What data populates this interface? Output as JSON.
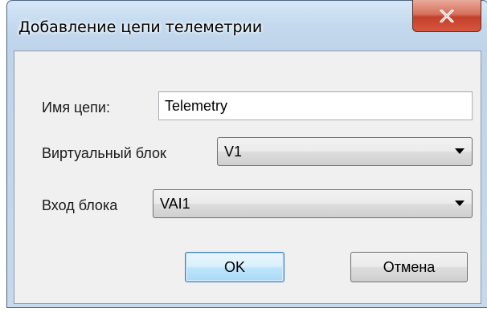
{
  "window": {
    "title": "Добавление цепи телеметрии",
    "close_glyph": "X"
  },
  "form": {
    "chain_name_label": "Имя цепи:",
    "chain_name_value": "Telemetry",
    "virtual_block_label": "Виртуальный блок",
    "virtual_block_value": "V1",
    "block_input_label": "Вход блока",
    "block_input_value": "VAI1"
  },
  "buttons": {
    "ok_label": "OK",
    "cancel_label": "Отмена"
  },
  "icons": {
    "close": "close-icon",
    "dropdown": "chevron-down-icon"
  },
  "colors": {
    "close_button": "#c3402a",
    "title_bar": "#c4d9ee",
    "client_area": "#f0f0f0",
    "default_button_border": "#3c7fb1"
  }
}
